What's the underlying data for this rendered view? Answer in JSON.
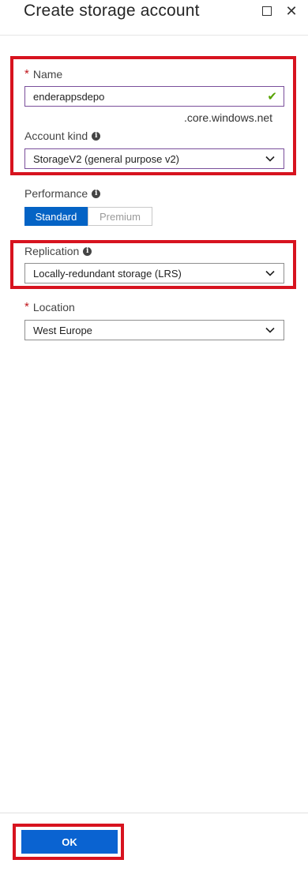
{
  "header": {
    "title": "Create storage account",
    "maximize_icon": "maximize-icon",
    "close_icon": "close-icon"
  },
  "form": {
    "name": {
      "required_mark": "*",
      "label": "Name",
      "value": "enderappsdepo",
      "valid_icon": "checkmark-icon",
      "suffix": ".core.windows.net"
    },
    "account_kind": {
      "label": "Account kind",
      "value": "StorageV2 (general purpose v2)"
    },
    "performance": {
      "label": "Performance",
      "options": [
        "Standard",
        "Premium"
      ],
      "selected": "Standard"
    },
    "replication": {
      "label": "Replication",
      "value": "Locally-redundant storage (LRS)"
    },
    "location": {
      "required_mark": "*",
      "label": "Location",
      "value": "West Europe"
    }
  },
  "footer": {
    "ok_label": "OK"
  },
  "colors": {
    "accent": "#0463c5",
    "highlight": "#d7131f",
    "valid": "#57a300",
    "required": "#c0161c"
  }
}
